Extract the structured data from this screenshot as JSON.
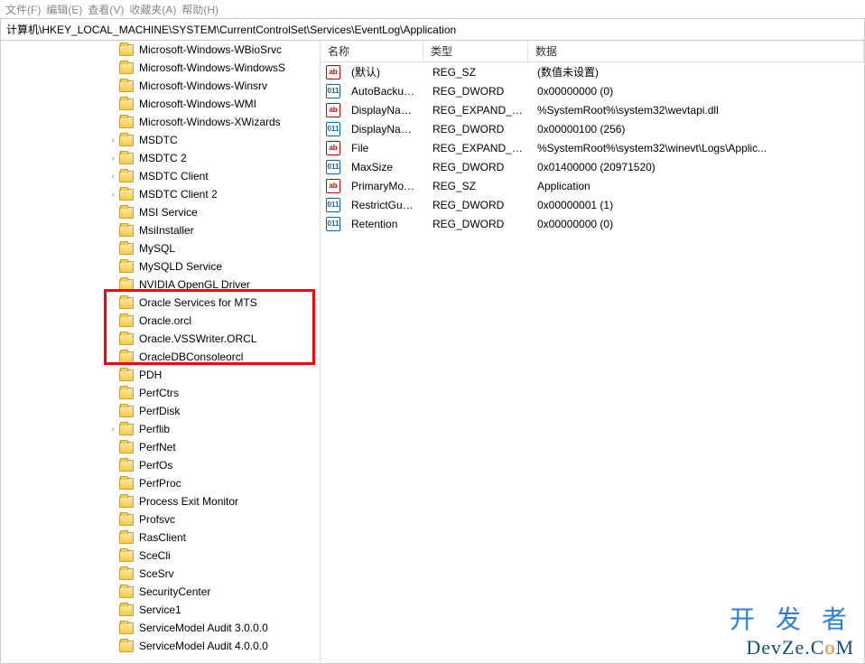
{
  "menu": {
    "file": "文件(F)",
    "edit": "编辑(E)",
    "view": "查看(V)",
    "favorites": "收藏夹(A)",
    "help": "帮助(H)"
  },
  "address": "计算机\\HKEY_LOCAL_MACHINE\\SYSTEM\\CurrentControlSet\\Services\\EventLog\\Application",
  "tree": [
    "Microsoft-Windows-WBioSrvc",
    "Microsoft-Windows-WindowsS",
    "Microsoft-Windows-Winsrv",
    "Microsoft-Windows-WMI",
    "Microsoft-Windows-XWizards",
    "MSDTC",
    "MSDTC 2",
    "MSDTC Client",
    "MSDTC Client 2",
    "MSI Service",
    "MsiInstaller",
    "MySQL",
    "MySQLD Service",
    "NVIDIA OpenGL Driver",
    "Oracle Services for MTS",
    "Oracle.orcl",
    "Oracle.VSSWriter.ORCL",
    "OracleDBConsoleorcl",
    "PDH",
    "PerfCtrs",
    "PerfDisk",
    "Perflib",
    "PerfNet",
    "PerfOs",
    "PerfProc",
    "Process Exit Monitor",
    "Profsvc",
    "RasClient",
    "SceCli",
    "SceSrv",
    "SecurityCenter",
    "Service1",
    "ServiceModel Audit 3.0.0.0",
    "ServiceModel Audit 4.0.0.0"
  ],
  "expandable": [
    "MSDTC",
    "MSDTC 2",
    "MSDTC Client",
    "MSDTC Client 2",
    "Perflib"
  ],
  "columns": {
    "name": "名称",
    "type": "类型",
    "data": "数据"
  },
  "values": [
    {
      "icon": "str",
      "name": "(默认)",
      "type": "REG_SZ",
      "data": "(数值未设置)"
    },
    {
      "icon": "bin",
      "name": "AutoBackupLo...",
      "type": "REG_DWORD",
      "data": "0x00000000 (0)"
    },
    {
      "icon": "str",
      "name": "DisplayNameFile",
      "type": "REG_EXPAND_SZ",
      "data": "%SystemRoot%\\system32\\wevtapi.dll"
    },
    {
      "icon": "bin",
      "name": "DisplayNameID",
      "type": "REG_DWORD",
      "data": "0x00000100 (256)"
    },
    {
      "icon": "str",
      "name": "File",
      "type": "REG_EXPAND_SZ",
      "data": "%SystemRoot%\\system32\\winevt\\Logs\\Applic..."
    },
    {
      "icon": "bin",
      "name": "MaxSize",
      "type": "REG_DWORD",
      "data": "0x01400000 (20971520)"
    },
    {
      "icon": "str",
      "name": "PrimaryModule",
      "type": "REG_SZ",
      "data": "Application"
    },
    {
      "icon": "bin",
      "name": "RestrictGuestA...",
      "type": "REG_DWORD",
      "data": "0x00000001 (1)"
    },
    {
      "icon": "bin",
      "name": "Retention",
      "type": "REG_DWORD",
      "data": "0x00000000 (0)"
    }
  ],
  "watermark": {
    "cn": "开 发 者",
    "en_pre": "DevZe.C",
    "en_o": "o",
    "en_post": "M"
  }
}
